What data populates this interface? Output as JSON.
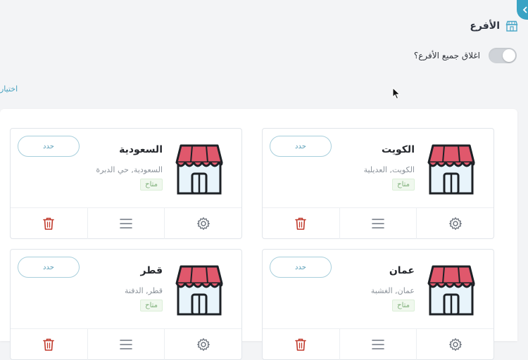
{
  "header": {
    "section_title": "الأفرع",
    "section_icon": "store-icon",
    "collapse_icon": "chevron-left-icon"
  },
  "close_all": {
    "label": "اغلاق جميع الأفرع؟",
    "enabled": false
  },
  "side_link": "اختيار",
  "colors": {
    "accent": "#3aa3c4",
    "awning": "#e0586c",
    "awning_dark": "#c94356",
    "store_body": "#e8f4fb",
    "delete": "#c0392b",
    "badge_text": "#7fb07a"
  },
  "branches": [
    {
      "name": "السعودية",
      "address": "السعودية, حي الدبرة",
      "status": "متاح",
      "select_label": "حدد"
    },
    {
      "name": "الكويت",
      "address": "الكويت, العديلية",
      "status": "متاح",
      "select_label": "حدد"
    },
    {
      "name": "قطر",
      "address": "قطر, الدفنة",
      "status": "متاح",
      "select_label": "حدد"
    },
    {
      "name": "عمان",
      "address": "عمان, الغشبة",
      "status": "متاح",
      "select_label": "حدد"
    }
  ]
}
